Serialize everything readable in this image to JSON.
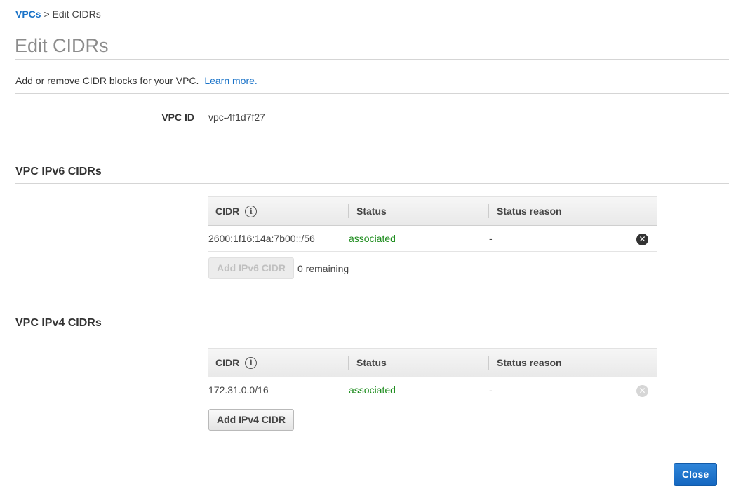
{
  "breadcrumb": {
    "root": "VPCs",
    "separator": ">",
    "current": "Edit CIDRs"
  },
  "page": {
    "title": "Edit CIDRs",
    "description": "Add or remove CIDR blocks for your VPC.",
    "learn_more": "Learn more."
  },
  "vpc": {
    "id_label": "VPC ID",
    "id_value": "vpc-4f1d7f27"
  },
  "ipv6": {
    "section_title": "VPC IPv6 CIDRs",
    "columns": {
      "cidr": "CIDR",
      "status": "Status",
      "reason": "Status reason"
    },
    "rows": [
      {
        "cidr": "2600:1f16:14a:7b00::/56",
        "status": "associated",
        "reason": "-",
        "remove_enabled": true
      }
    ],
    "add_button": "Add IPv6 CIDR",
    "add_enabled": false,
    "remaining": "0 remaining"
  },
  "ipv4": {
    "section_title": "VPC IPv4 CIDRs",
    "columns": {
      "cidr": "CIDR",
      "status": "Status",
      "reason": "Status reason"
    },
    "rows": [
      {
        "cidr": "172.31.0.0/16",
        "status": "associated",
        "reason": "-",
        "remove_enabled": false
      }
    ],
    "add_button": "Add IPv4 CIDR",
    "add_enabled": true
  },
  "footer": {
    "close_button": "Close"
  },
  "icons": {
    "info": "info-icon",
    "remove": "remove-circle-x-icon"
  },
  "colors": {
    "link": "#1a73c8",
    "status_ok": "#1d8c1d",
    "primary": "#1467c0"
  }
}
